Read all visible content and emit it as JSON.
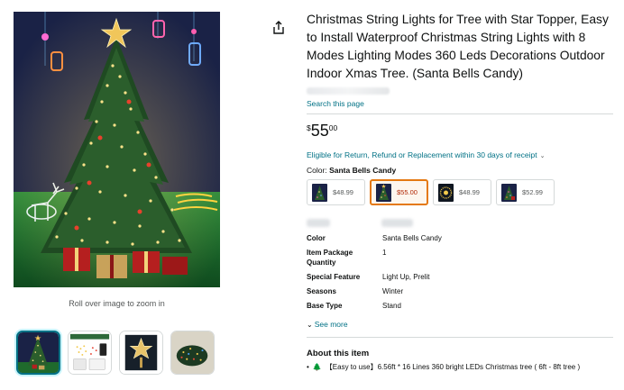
{
  "gallery": {
    "zoom_hint": "Roll over image to zoom in",
    "thumbnails": [
      "tree-photo",
      "light-string-package",
      "star-topper",
      "light-bundle"
    ]
  },
  "product": {
    "title": "Christmas String Lights for Tree with Star Topper, Easy to Install Waterproof Christmas String Lights with 8 Modes Lighting Modes 360 Leds Decorations Outdoor Indoor Xmas Tree. (Santa Bells Candy)",
    "store_link": "Search this page",
    "price": {
      "symbol": "$",
      "whole": "55",
      "fraction": "00"
    },
    "returns_text": "Eligible for Return, Refund or Replacement within 30 days of receipt",
    "color_label": "Color:",
    "color_value": "Santa Bells Candy",
    "swatches": [
      {
        "price": "$48.99",
        "selected": false
      },
      {
        "price": "$55.00",
        "selected": true
      },
      {
        "price": "$48.99",
        "selected": false
      },
      {
        "price": "$52.99",
        "selected": false
      }
    ],
    "specs": [
      {
        "key": "Color",
        "value": "Santa Bells Candy"
      },
      {
        "key": "Item Package Quantity",
        "value": "1"
      },
      {
        "key": "Special Feature",
        "value": "Light Up, Prelit"
      },
      {
        "key": "Seasons",
        "value": "Winter"
      },
      {
        "key": "Base Type",
        "value": "Stand"
      }
    ],
    "see_more": "See more",
    "about_title": "About this item",
    "bullets": [
      "【Easy to use】6.56ft * 16 Lines 360 bright LEDs Christmas tree ( 6ft - 8ft tree )"
    ]
  },
  "colors": {
    "link": "#007185",
    "price_red": "#b12704",
    "selected_border": "#e47911",
    "thumb_selected": "#007185"
  }
}
